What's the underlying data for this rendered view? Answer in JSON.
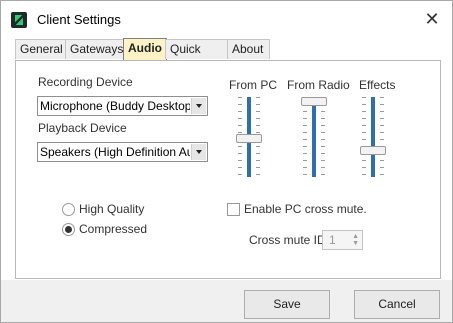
{
  "window": {
    "title": "Client Settings"
  },
  "tabs": [
    {
      "label": "General"
    },
    {
      "label": "Gateways"
    },
    {
      "label": "Audio"
    },
    {
      "label": "Quick Text"
    },
    {
      "label": "About"
    }
  ],
  "audio": {
    "recording_label": "Recording Device",
    "recording_value": "Microphone (Buddy DesktopMic",
    "playback_label": "Playback Device",
    "playback_value": "Speakers (High Definition Audio",
    "sliders": [
      {
        "label": "From PC",
        "level": 0.48
      },
      {
        "label": "From Radio",
        "level": 1.0
      },
      {
        "label": "Effects",
        "level": 0.31
      }
    ],
    "quality_options": [
      {
        "label": "High Quality",
        "selected": false
      },
      {
        "label": "Compressed",
        "selected": true
      }
    ],
    "cross_mute_label": "Enable PC cross mute.",
    "cross_mute_checked": false,
    "cross_mute_id_label": "Cross mute ID",
    "cross_mute_id_value": "1"
  },
  "buttons": {
    "save": "Save",
    "cancel": "Cancel"
  }
}
